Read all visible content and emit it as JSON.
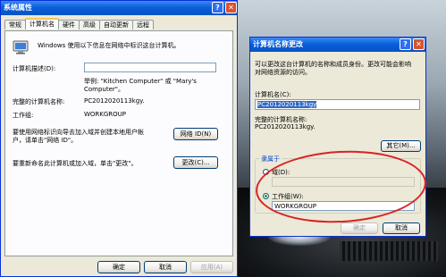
{
  "main_window": {
    "title": "系统属性",
    "tabs": [
      "常规",
      "计算机名",
      "硬件",
      "高级",
      "自动更新",
      "远程"
    ],
    "active_tab": "计算机名",
    "intro": "Windows 使用以下信息在网络中标识这台计算机。",
    "description_label": "计算机描述(D):",
    "description_value": "",
    "example_line1": "举例: \"Kitchen Computer\" 或 \"Mary's",
    "example_line2": "Computer\"。",
    "fullname_label": "完整的计算机名称:",
    "fullname_value": "PC2012020113kgy.",
    "workgroup_label": "工作组:",
    "workgroup_value": "WORKGROUP",
    "netid_text_line1": "要使用网络标识向导去加入域并创建本地用户帐",
    "netid_text_line2": "户，请单击\"网络 ID\"。",
    "netid_button": "网络 ID(N)",
    "change_text": "要重新命名此计算机或加入域，单击\"更改\"。",
    "change_button": "更改(C)...",
    "ok": "确定",
    "cancel": "取消",
    "apply": "应用(A)"
  },
  "rename_dialog": {
    "title": "计算机名称更改",
    "intro_line1": "可以更改这台计算机的名称和成员身份。更改可能会影响",
    "intro_line2": "对网络资源的访问。",
    "name_label": "计算机名(C):",
    "name_value": "PC2012020113kgy",
    "fullname_label": "完整的计算机名称:",
    "fullname_value": "PC2012020113kgy.",
    "other_button": "其它(M)...",
    "member_of": "隶属于",
    "domain_label": "域(D):",
    "domain_value": "",
    "workgroup_label": "工作组(W):",
    "workgroup_value": "WORKGROUP",
    "ok": "确定",
    "cancel": "取消"
  },
  "colors": {
    "title_blue": "#0a5fd8",
    "dialog_bg": "#ece9d8",
    "annotation_red": "#d92323"
  }
}
